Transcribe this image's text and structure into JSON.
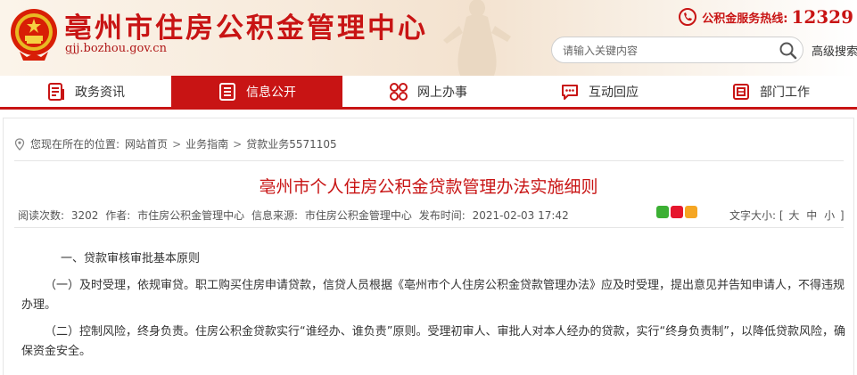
{
  "header": {
    "site_title": "亳州市住房公积金管理中心",
    "site_domain": "gjj.bozhou.gov.cn",
    "hotline_label": "公积金服务热线:",
    "hotline_number": "12329",
    "search_placeholder": "请输入关键内容",
    "advanced_search": "高级搜索"
  },
  "nav": {
    "items": [
      {
        "label": "政务资讯"
      },
      {
        "label": "信息公开"
      },
      {
        "label": "网上办事"
      },
      {
        "label": "互动回应"
      },
      {
        "label": "部门工作"
      }
    ],
    "active_index": 1
  },
  "breadcrumb": {
    "prefix": "您现在所在的位置:",
    "items": [
      "网站首页",
      "业务指南",
      "贷款业务5571105"
    ],
    "separator": ">"
  },
  "article": {
    "title": "亳州市个人住房公积金贷款管理办法实施细则",
    "meta": {
      "views_label": "阅读次数:",
      "views": "3202",
      "author_label": "作者:",
      "author": "市住房公积金管理中心",
      "source_label": "信息来源:",
      "source": "市住房公积金管理中心",
      "date_label": "发布时间:",
      "date": "2021-02-03 17:42"
    },
    "font_size": {
      "label": "文字大小:",
      "open": "[",
      "large": "大",
      "medium": "中",
      "small": "小",
      "close": "]"
    },
    "paragraphs": [
      "一、贷款审核审批基本原则",
      "（一）及时受理，依规审贷。职工购买住房申请贷款，信贷人员根据《亳州市个人住房公积金贷款管理办法》应及时受理，提出意见并告知申请人，不得违规办理。",
      "（二）控制风险，终身负责。住房公积金贷款实行“谁经办、谁负责”原则。受理初审人、审批人对本人经办的贷款，实行“终身负责制”，以降低贷款风险，确保资金安全。"
    ]
  },
  "colors": {
    "brand_red": "#c81414",
    "nav_active_bg": "#c81414",
    "share_wechat": "#3cb034",
    "share_weibo": "#e6162d",
    "share_qzone": "#f5a623"
  }
}
